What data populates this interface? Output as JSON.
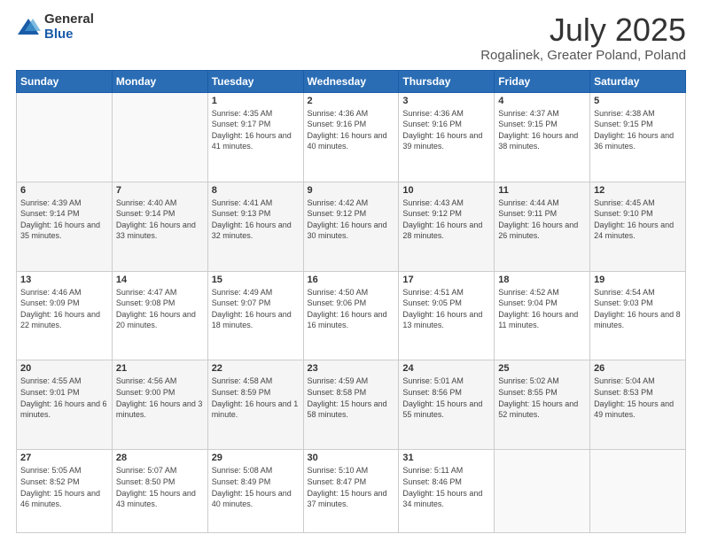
{
  "logo": {
    "general": "General",
    "blue": "Blue"
  },
  "title": "July 2025",
  "subtitle": "Rogalinek, Greater Poland, Poland",
  "days_header": [
    "Sunday",
    "Monday",
    "Tuesday",
    "Wednesday",
    "Thursday",
    "Friday",
    "Saturday"
  ],
  "weeks": [
    [
      {
        "num": "",
        "info": ""
      },
      {
        "num": "",
        "info": ""
      },
      {
        "num": "1",
        "info": "Sunrise: 4:35 AM\nSunset: 9:17 PM\nDaylight: 16 hours and 41 minutes."
      },
      {
        "num": "2",
        "info": "Sunrise: 4:36 AM\nSunset: 9:16 PM\nDaylight: 16 hours and 40 minutes."
      },
      {
        "num": "3",
        "info": "Sunrise: 4:36 AM\nSunset: 9:16 PM\nDaylight: 16 hours and 39 minutes."
      },
      {
        "num": "4",
        "info": "Sunrise: 4:37 AM\nSunset: 9:15 PM\nDaylight: 16 hours and 38 minutes."
      },
      {
        "num": "5",
        "info": "Sunrise: 4:38 AM\nSunset: 9:15 PM\nDaylight: 16 hours and 36 minutes."
      }
    ],
    [
      {
        "num": "6",
        "info": "Sunrise: 4:39 AM\nSunset: 9:14 PM\nDaylight: 16 hours and 35 minutes."
      },
      {
        "num": "7",
        "info": "Sunrise: 4:40 AM\nSunset: 9:14 PM\nDaylight: 16 hours and 33 minutes."
      },
      {
        "num": "8",
        "info": "Sunrise: 4:41 AM\nSunset: 9:13 PM\nDaylight: 16 hours and 32 minutes."
      },
      {
        "num": "9",
        "info": "Sunrise: 4:42 AM\nSunset: 9:12 PM\nDaylight: 16 hours and 30 minutes."
      },
      {
        "num": "10",
        "info": "Sunrise: 4:43 AM\nSunset: 9:12 PM\nDaylight: 16 hours and 28 minutes."
      },
      {
        "num": "11",
        "info": "Sunrise: 4:44 AM\nSunset: 9:11 PM\nDaylight: 16 hours and 26 minutes."
      },
      {
        "num": "12",
        "info": "Sunrise: 4:45 AM\nSunset: 9:10 PM\nDaylight: 16 hours and 24 minutes."
      }
    ],
    [
      {
        "num": "13",
        "info": "Sunrise: 4:46 AM\nSunset: 9:09 PM\nDaylight: 16 hours and 22 minutes."
      },
      {
        "num": "14",
        "info": "Sunrise: 4:47 AM\nSunset: 9:08 PM\nDaylight: 16 hours and 20 minutes."
      },
      {
        "num": "15",
        "info": "Sunrise: 4:49 AM\nSunset: 9:07 PM\nDaylight: 16 hours and 18 minutes."
      },
      {
        "num": "16",
        "info": "Sunrise: 4:50 AM\nSunset: 9:06 PM\nDaylight: 16 hours and 16 minutes."
      },
      {
        "num": "17",
        "info": "Sunrise: 4:51 AM\nSunset: 9:05 PM\nDaylight: 16 hours and 13 minutes."
      },
      {
        "num": "18",
        "info": "Sunrise: 4:52 AM\nSunset: 9:04 PM\nDaylight: 16 hours and 11 minutes."
      },
      {
        "num": "19",
        "info": "Sunrise: 4:54 AM\nSunset: 9:03 PM\nDaylight: 16 hours and 8 minutes."
      }
    ],
    [
      {
        "num": "20",
        "info": "Sunrise: 4:55 AM\nSunset: 9:01 PM\nDaylight: 16 hours and 6 minutes."
      },
      {
        "num": "21",
        "info": "Sunrise: 4:56 AM\nSunset: 9:00 PM\nDaylight: 16 hours and 3 minutes."
      },
      {
        "num": "22",
        "info": "Sunrise: 4:58 AM\nSunset: 8:59 PM\nDaylight: 16 hours and 1 minute."
      },
      {
        "num": "23",
        "info": "Sunrise: 4:59 AM\nSunset: 8:58 PM\nDaylight: 15 hours and 58 minutes."
      },
      {
        "num": "24",
        "info": "Sunrise: 5:01 AM\nSunset: 8:56 PM\nDaylight: 15 hours and 55 minutes."
      },
      {
        "num": "25",
        "info": "Sunrise: 5:02 AM\nSunset: 8:55 PM\nDaylight: 15 hours and 52 minutes."
      },
      {
        "num": "26",
        "info": "Sunrise: 5:04 AM\nSunset: 8:53 PM\nDaylight: 15 hours and 49 minutes."
      }
    ],
    [
      {
        "num": "27",
        "info": "Sunrise: 5:05 AM\nSunset: 8:52 PM\nDaylight: 15 hours and 46 minutes."
      },
      {
        "num": "28",
        "info": "Sunrise: 5:07 AM\nSunset: 8:50 PM\nDaylight: 15 hours and 43 minutes."
      },
      {
        "num": "29",
        "info": "Sunrise: 5:08 AM\nSunset: 8:49 PM\nDaylight: 15 hours and 40 minutes."
      },
      {
        "num": "30",
        "info": "Sunrise: 5:10 AM\nSunset: 8:47 PM\nDaylight: 15 hours and 37 minutes."
      },
      {
        "num": "31",
        "info": "Sunrise: 5:11 AM\nSunset: 8:46 PM\nDaylight: 15 hours and 34 minutes."
      },
      {
        "num": "",
        "info": ""
      },
      {
        "num": "",
        "info": ""
      }
    ]
  ]
}
